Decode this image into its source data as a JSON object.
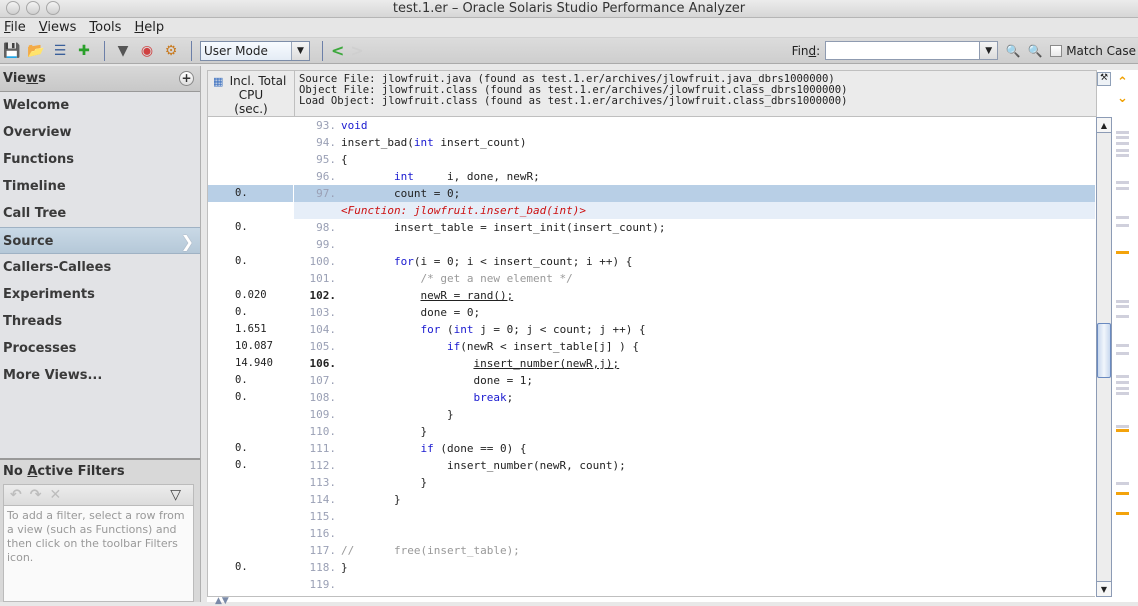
{
  "window": {
    "title": "test.1.er  –  Oracle Solaris Studio Performance Analyzer"
  },
  "menu": [
    {
      "label": "File",
      "mnemonic": "F",
      "rest": "ile"
    },
    {
      "label": "Views",
      "mnemonic": "V",
      "rest": "iews"
    },
    {
      "label": "Tools",
      "mnemonic": "T",
      "rest": "ools"
    },
    {
      "label": "Help",
      "mnemonic": "H",
      "rest": "elp"
    }
  ],
  "toolbar": {
    "icons": [
      "save-experiment-icon",
      "open-experiment-icon",
      "compare-icon",
      "add-experiment-icon",
      "filter-icon",
      "function-color-icon",
      "settings-icon"
    ],
    "mode": "User Mode",
    "find_label_pre": "Fin",
    "find_label_mn": "d",
    "find_label_post": ":",
    "find_value": "",
    "match_case_label": "Match Case",
    "match_case_checked": false
  },
  "sidebar": {
    "views_pre": "Vie",
    "views_mn": "w",
    "views_post": "s",
    "items": [
      {
        "label": "Welcome",
        "active": false
      },
      {
        "label": "Overview",
        "active": false
      },
      {
        "label": "Functions",
        "active": false
      },
      {
        "label": "Timeline",
        "active": false
      },
      {
        "label": "Call Tree",
        "active": false
      },
      {
        "label": "Source",
        "active": true
      },
      {
        "label": "Callers-Callees",
        "active": false
      },
      {
        "label": "Experiments",
        "active": false
      },
      {
        "label": "Threads",
        "active": false
      },
      {
        "label": "Processes",
        "active": false
      },
      {
        "label": "More Views...",
        "active": false
      }
    ],
    "filters": {
      "title_pre": "No ",
      "title_mn": "A",
      "title_post": "ctive Filters",
      "help": "To add a filter, select a row from a view (such as Functions) and then click on the toolbar Filters icon."
    }
  },
  "source": {
    "metric_header": [
      "Incl. Total",
      "CPU",
      "(sec.)"
    ],
    "info": [
      "Source File: jlowfruit.java (found as test.1.er/archives/jlowfruit.java_dbrs1000000)",
      "Object File: jlowfruit.class (found as test.1.er/archives/jlowfruit.class_dbrs1000000)",
      "Load Object: jlowfruit.class (found as test.1.er/archives/jlowfruit.class_dbrs1000000)"
    ],
    "function_marker": "<Function: jlowfruit.insert_bad(int)>",
    "lines": [
      {
        "metric": "",
        "ln": "93.",
        "code": "void",
        "hot": false
      },
      {
        "metric": "",
        "ln": "94.",
        "code": "insert_bad(int insert_count)",
        "hot": false
      },
      {
        "metric": "",
        "ln": "95.",
        "code": "{",
        "hot": false
      },
      {
        "metric": "",
        "ln": "96.",
        "code": "        int     i, done, newR;",
        "hot": false
      },
      {
        "metric": "0.",
        "ln": "97.",
        "code": "        count = 0;",
        "hot": false,
        "selected": true
      },
      {
        "metric": "0.",
        "ln": "98.",
        "code": "        insert_table = insert_init(insert_count);",
        "hot": false
      },
      {
        "metric": "",
        "ln": "99.",
        "code": "",
        "hot": false
      },
      {
        "metric": "0.",
        "ln": "100.",
        "code": "        for(i = 0; i < insert_count; i ++) {",
        "hot": false
      },
      {
        "metric": "",
        "ln": "101.",
        "code": "            /* get a new element */",
        "hot": false
      },
      {
        "metric": "0.020",
        "ln": "102.",
        "code": "            newR = rand();",
        "hot": true
      },
      {
        "metric": "0.",
        "ln": "103.",
        "code": "            done = 0;",
        "hot": false
      },
      {
        "metric": "1.651",
        "ln": "104.",
        "code": "            for (int j = 0; j < count; j ++) {",
        "hot": false
      },
      {
        "metric": "10.087",
        "ln": "105.",
        "code": "                if(newR < insert_table[j] ) {",
        "hot": false
      },
      {
        "metric": "14.940",
        "ln": "106.",
        "code": "                    insert_number(newR,j);",
        "hot": true
      },
      {
        "metric": "0.",
        "ln": "107.",
        "code": "                    done = 1;",
        "hot": false
      },
      {
        "metric": "0.",
        "ln": "108.",
        "code": "                    break;",
        "hot": false
      },
      {
        "metric": "",
        "ln": "109.",
        "code": "                }",
        "hot": false
      },
      {
        "metric": "",
        "ln": "110.",
        "code": "            }",
        "hot": false
      },
      {
        "metric": "0.",
        "ln": "111.",
        "code": "            if (done == 0) {",
        "hot": false
      },
      {
        "metric": "0.",
        "ln": "112.",
        "code": "                insert_number(newR, count);",
        "hot": false
      },
      {
        "metric": "",
        "ln": "113.",
        "code": "            }",
        "hot": false
      },
      {
        "metric": "",
        "ln": "114.",
        "code": "        }",
        "hot": false
      },
      {
        "metric": "",
        "ln": "115.",
        "code": "",
        "hot": false
      },
      {
        "metric": "",
        "ln": "116.",
        "code": "",
        "hot": false
      },
      {
        "metric": "",
        "ln": "117.",
        "code": "//      free(insert_table);",
        "hot": false
      },
      {
        "metric": "0.",
        "ln": "118.",
        "code": "}",
        "hot": false
      },
      {
        "metric": "",
        "ln": "119.",
        "code": "",
        "hot": false
      }
    ]
  },
  "colors": {
    "selection": "#b8cfe6",
    "keyword": "#1a1ad0",
    "function_marker": "#cc1010",
    "hot_mark": "#f3a30c"
  }
}
